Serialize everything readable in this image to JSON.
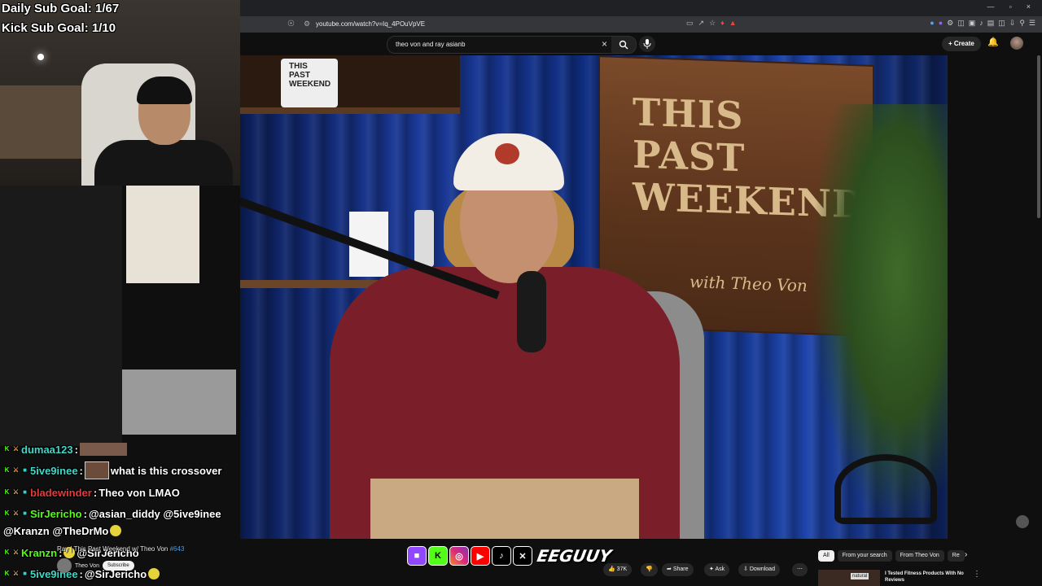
{
  "overlay": {
    "daily_sub_goal": "Daily Sub Goal: 1/67",
    "kick_sub_goal": "Kick Sub Goal: 1/10"
  },
  "browser": {
    "url": "youtube.com/watch?v=Iq_4POuVpVE",
    "window_controls": [
      "—",
      "▫",
      "×"
    ]
  },
  "youtube": {
    "search_query": "theo von and ray asianb",
    "create_label": "Create",
    "video": {
      "sign_text": "THIS PAST WEEKEND",
      "sign_sub": "with Theo Von",
      "mug_text": "THIS PAST WEEKEND"
    },
    "title_strip": "Ray | This Past Weekend w/ Theo Von",
    "episode": "#643",
    "channel_name": "Theo Von",
    "subscribe_label": "Subscribe",
    "actions": {
      "likes": "37K",
      "share": "Share",
      "ask": "Ask",
      "download": "Download"
    },
    "chips": [
      "All",
      "From your search",
      "From Theo Von",
      "Re"
    ],
    "rec_title": "I Tested Fitness Products With No Reviews",
    "rec_thumb_text": "natural"
  },
  "chat": [
    {
      "name": "dumaa123",
      "name_color": "teal",
      "sep": " :",
      "message": "",
      "has_image": true
    },
    {
      "name": "5ive9inee",
      "name_color": "teal",
      "sep": " :",
      "message": "what is this crossover",
      "has_face": true
    },
    {
      "name": "bladewinder",
      "name_color": "red",
      "sep": " :",
      "message": "Theo von LMAO"
    },
    {
      "name": "SirJericho",
      "name_color": "green",
      "sep": " :",
      "message": "@asian_diddy @5ive9inee"
    },
    {
      "name": "",
      "name_color": "teal",
      "sep": "",
      "message": "@Kranzn @TheDrMo"
    },
    {
      "name": "Kranzn",
      "name_color": "green",
      "sep": " :",
      "message": "@SirJericho"
    },
    {
      "name": "5ive9inee",
      "name_color": "teal",
      "sep": " :",
      "message": "@SirJericho"
    }
  ],
  "brand": "EEGUUY",
  "icons": {
    "bookmark": "bookmark-icon",
    "search": "search-icon",
    "mic": "mic-icon",
    "bell": "bell-icon",
    "clear": "close-icon"
  }
}
